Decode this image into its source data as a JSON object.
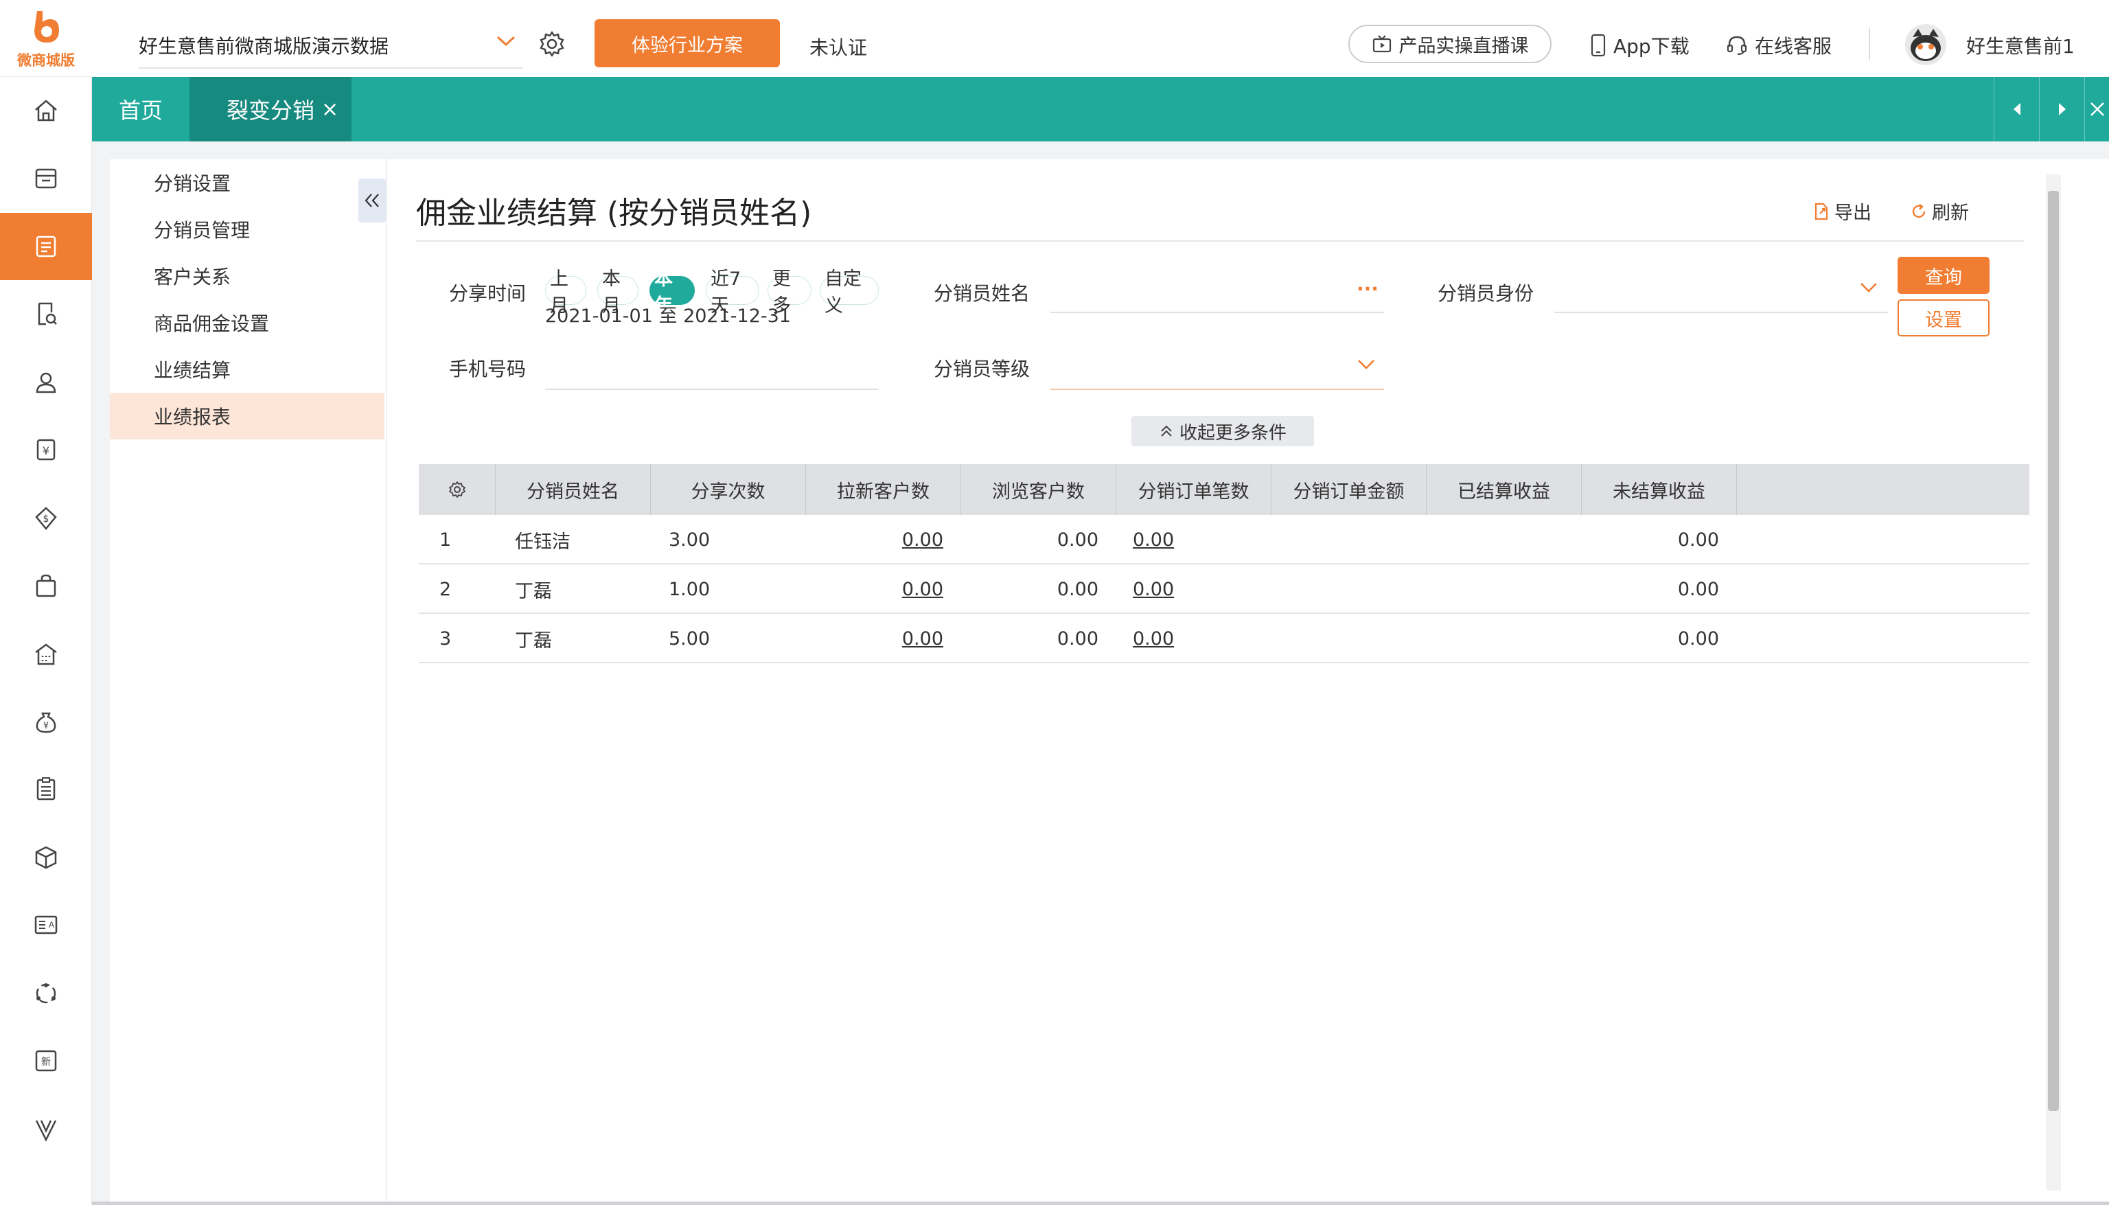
{
  "logo": {
    "text": "微商城版"
  },
  "topbar": {
    "shop": "好生意售前微商城版演示数据",
    "trial_button": "体验行业方案",
    "cert_status": "未认证",
    "live_course": "产品实操直播课",
    "app_download": "App下载",
    "customer_service": "在线客服",
    "user_name": "好生意售前1"
  },
  "tabs": {
    "home": "首页",
    "active": "裂变分销",
    "close": "×"
  },
  "submenu": [
    "分销设置",
    "分销员管理",
    "客户关系",
    "商品佣金设置",
    "业绩结算",
    "业绩报表"
  ],
  "page": {
    "title": "佣金业绩结算 (按分销员姓名)",
    "export": "导出",
    "refresh": "刷新"
  },
  "filters": {
    "share_time_label": "分享时间",
    "periods": [
      "上月",
      "本月",
      "本年",
      "近7天",
      "更多",
      "自定义"
    ],
    "selected_period": "本年",
    "date_range": "2021-01-01 至 2021-12-31",
    "distributor_name_label": "分销员姓名",
    "distributor_identity_label": "分销员身份",
    "phone_label": "手机号码",
    "distributor_level_label": "分销员等级",
    "more_icon": "···",
    "query": "查询",
    "settings": "设置",
    "collapse_more": "收起更多条件"
  },
  "table": {
    "columns": [
      "分销员姓名",
      "分享次数",
      "拉新客户数",
      "浏览客户数",
      "分销订单笔数",
      "分销订单金额",
      "已结算收益",
      "未结算收益"
    ],
    "rows": [
      {
        "idx": "1",
        "name": "任钰洁",
        "shares": "3.00",
        "new_customers": "0.00",
        "browse_customers": "0.00",
        "orders": "0.00",
        "unsettled": "0.00"
      },
      {
        "idx": "2",
        "name": "丁磊",
        "shares": "1.00",
        "new_customers": "0.00",
        "browse_customers": "0.00",
        "orders": "0.00",
        "unsettled": "0.00"
      },
      {
        "idx": "3",
        "name": "丁磊",
        "shares": "5.00",
        "new_customers": "0.00",
        "browse_customers": "0.00",
        "orders": "0.00",
        "unsettled": "0.00"
      }
    ]
  },
  "colors": {
    "brand": "#f07d31",
    "teal": "#1faa9c",
    "teal_dark": "#178a7f"
  }
}
